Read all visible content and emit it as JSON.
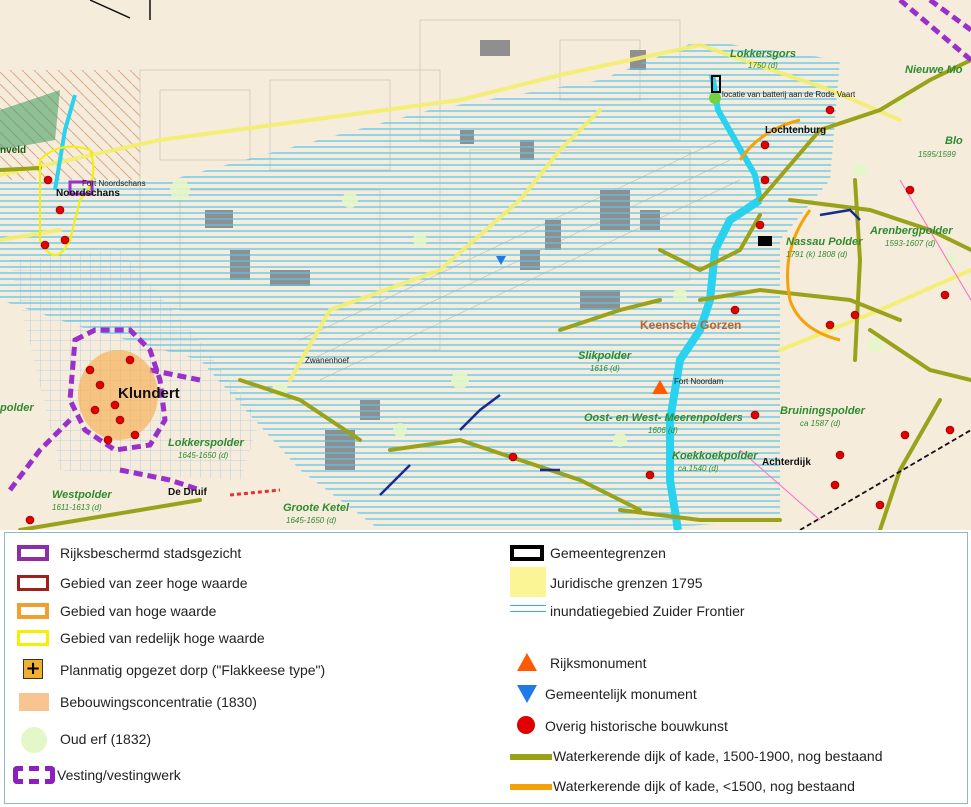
{
  "map": {
    "places": {
      "klundert": "Klundert",
      "noordschans": "Noordschans",
      "fort_noordschans": "Fort Noordschans",
      "lochtenburg": "Lochtenburg",
      "zwanenhoef": "Zwanenhoef",
      "fort_noordam": "Fort Noordam",
      "achterdijk": "Achterdijk",
      "de_druif": "De Druif",
      "keensche_gorzen": "Keensche Gorzen",
      "locatie_batterij": "locatie van batterij aan de Rode Vaart",
      "nveld": "nveld"
    },
    "polders": [
      {
        "name": "Lokkersgors",
        "sub": "1750 (d)"
      },
      {
        "name": "Nieuwe Mo",
        "sub": ""
      },
      {
        "name": "Blo",
        "sub": "1595/1599"
      },
      {
        "name": "Arenbergpolder",
        "sub": "1593-1607 (d)"
      },
      {
        "name": "Nassau Polder",
        "sub": "1791 (k) 1808 (d)"
      },
      {
        "name": "Slikpolder",
        "sub": "1616 (d)"
      },
      {
        "name": "Oost- en West- Meerenpolders",
        "sub": "1606 (d)"
      },
      {
        "name": "Koekkoekpolder",
        "sub": "ca.1540 (d)"
      },
      {
        "name": "Bruiningspolder",
        "sub": "ca 1587 (d)"
      },
      {
        "name": "Lokkerspolder",
        "sub": "1645-1650 (d)"
      },
      {
        "name": "Westpolder",
        "sub": "1611-1613 (d)"
      },
      {
        "name": "Groote Ketel",
        "sub": "1645-1650 (d)"
      },
      {
        "name": "polder",
        "sub": ""
      }
    ]
  },
  "legend": {
    "left": [
      {
        "label": "Rijksbeschermd stadsgezicht",
        "icon": "purple-rect-icon",
        "color": "#8e2da8"
      },
      {
        "label": "Gebied van zeer hoge waarde",
        "icon": "darkred-rect-icon",
        "color": "#a0201c"
      },
      {
        "label": "Gebied van hoge waarde",
        "icon": "orange-rect-icon",
        "color": "#f0a030"
      },
      {
        "label": "Gebied van redelijk hoge waarde",
        "icon": "yellow-rect-icon",
        "color": "#f5f000"
      },
      {
        "label": "Planmatig opgezet dorp (\"Flakkeese type\")",
        "icon": "plus-square-icon",
        "color": "#f0b030"
      },
      {
        "label": "Bebouwingsconcentratie (1830)",
        "icon": "peach-square-icon",
        "color": "#f8c490"
      },
      {
        "label": "Oud erf (1832)",
        "icon": "pale-green-circle-icon",
        "color": "#e4f7c8"
      },
      {
        "label": "Vesting/vestingwerk",
        "icon": "purple-dashed-rect-icon",
        "color": "#8e1fbf"
      }
    ],
    "right": [
      {
        "label": "Gemeentegrenzen",
        "icon": "black-rect-icon",
        "color": "#000000"
      },
      {
        "label": "Juridische grenzen 1795",
        "icon": "pale-yellow-line-icon",
        "color": "#fbf37a"
      },
      {
        "label": "inundatiegebied Zuider Frontier",
        "icon": "cyan-double-line-icon",
        "color": "#29b5e8"
      },
      {
        "label": "Rijksmonument",
        "icon": "orange-triangle-icon",
        "color": "#ff5a00"
      },
      {
        "label": "Gemeentelijk monument",
        "icon": "blue-triangle-down-icon",
        "color": "#1f7ae8"
      },
      {
        "label": "Overig historische bouwkunst",
        "icon": "red-circle-icon",
        "color": "#e00000"
      },
      {
        "label": "Waterkerende dijk of kade, 1500-1900, nog bestaand",
        "icon": "olive-line-icon",
        "color": "#9aa21a"
      },
      {
        "label": "Waterkerende dijk of kade, <1500, nog bestaand",
        "icon": "orange-line-icon",
        "color": "#f5a20a"
      }
    ]
  }
}
